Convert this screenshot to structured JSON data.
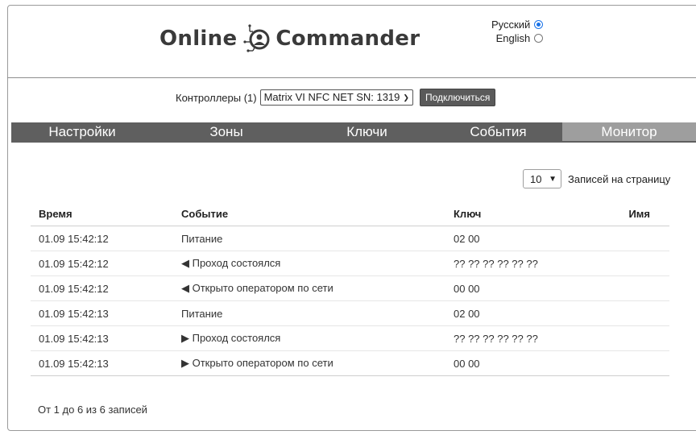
{
  "header": {
    "logo_left": "Online",
    "logo_right": "Commander",
    "languages": [
      {
        "label": "Русский",
        "selected": true
      },
      {
        "label": "English",
        "selected": false
      }
    ]
  },
  "controller": {
    "label": "Контроллеры (1)",
    "selected": "Matrix VI NFC NET SN: 1319",
    "connect_label": "Подключиться"
  },
  "tabs": [
    {
      "label": "Настройки",
      "active": false
    },
    {
      "label": "Зоны",
      "active": false
    },
    {
      "label": "Ключи",
      "active": false
    },
    {
      "label": "События",
      "active": false
    },
    {
      "label": "Монитор",
      "active": true
    }
  ],
  "pager": {
    "page_size": "10",
    "label": "Записей на страницу"
  },
  "table": {
    "columns": [
      "Время",
      "Событие",
      "Ключ",
      "Имя"
    ],
    "rows": [
      {
        "time": "01.09 15:42:12",
        "event": "Питание",
        "key": "02 00",
        "name": ""
      },
      {
        "time": "01.09 15:42:12",
        "event": "◀ Проход состоялся",
        "key": "?? ?? ?? ?? ?? ??",
        "name": ""
      },
      {
        "time": "01.09 15:42:12",
        "event": "◀ Открыто оператором по сети",
        "key": "00 00",
        "name": ""
      },
      {
        "time": "01.09 15:42:13",
        "event": "Питание",
        "key": "02 00",
        "name": ""
      },
      {
        "time": "01.09 15:42:13",
        "event": "▶ Проход состоялся",
        "key": "?? ?? ?? ?? ?? ??",
        "name": ""
      },
      {
        "time": "01.09 15:42:13",
        "event": "▶ Открыто оператором по сети",
        "key": "00 00",
        "name": ""
      }
    ]
  },
  "footer": {
    "info": "От 1 до 6 из 6 записей"
  },
  "colors": {
    "tab_bg": "#5f5f5f",
    "tab_active_bg": "#9e9e9e",
    "radio_accent": "#1a73e8"
  }
}
